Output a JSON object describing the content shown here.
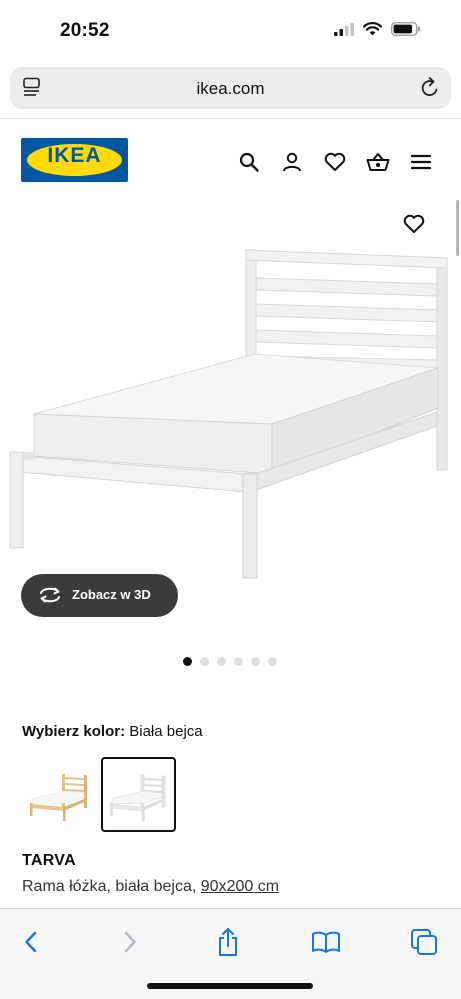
{
  "status_bar": {
    "time": "20:52"
  },
  "browser": {
    "url": "ikea.com"
  },
  "site": {
    "logo_text": "IKEA",
    "brand_blue": "#0058a3",
    "brand_yellow": "#ffdb00"
  },
  "header_icons": [
    "search-icon",
    "account-icon",
    "heart-icon",
    "basket-icon",
    "menu-icon"
  ],
  "gallery": {
    "view_3d_label": "Zobacz w 3D",
    "dots_total": 6,
    "active_dot": 1
  },
  "color_picker": {
    "label": "Wybierz kolor:",
    "selected": "Biała bejca",
    "options": [
      "pine-bed-thumbnail",
      "white-stain-bed-thumbnail"
    ]
  },
  "product": {
    "name": "TARVA",
    "description": "Rama łóżka, biała bejca,",
    "size": "90x200 cm"
  },
  "toolbar": [
    "back-icon",
    "forward-icon",
    "share-icon",
    "bookmarks-icon",
    "tabs-icon"
  ]
}
